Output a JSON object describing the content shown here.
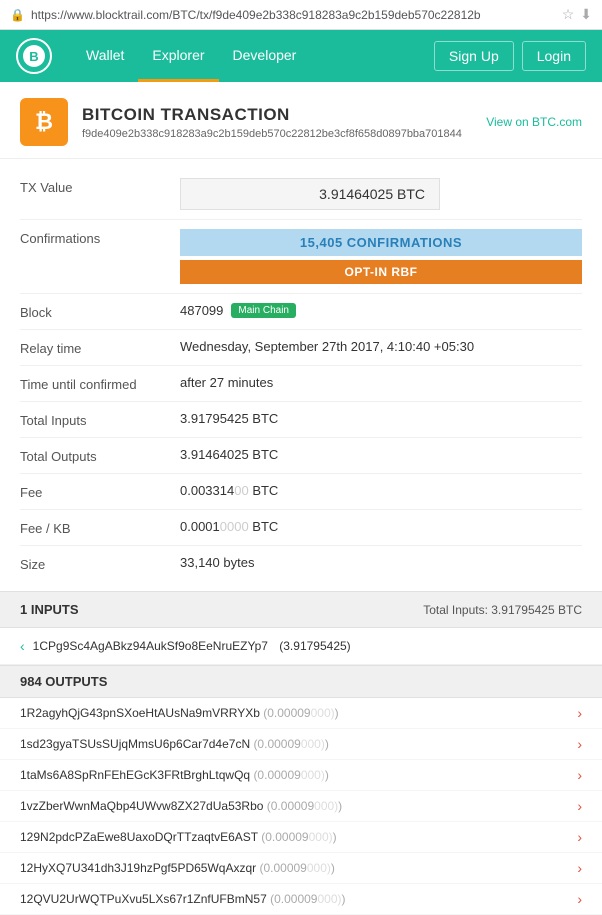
{
  "urlbar": {
    "url": "https://www.blocktrail.com/BTC/tx/f9de409e2b338c918283a9c2b159deb570c22812b",
    "lock_symbol": "🔒"
  },
  "nav": {
    "logo_letter": "B",
    "links": [
      {
        "label": "Wallet",
        "active": false
      },
      {
        "label": "Explorer",
        "active": true
      },
      {
        "label": "Developer",
        "active": false
      }
    ],
    "right_buttons": [
      {
        "label": "Sign Up"
      },
      {
        "label": "Login"
      }
    ]
  },
  "transaction": {
    "icon": "₿",
    "title": "BITCOIN TRANSACTION",
    "hash": "f9de409e2b338c918283a9c2b159deb570c22812be3cf8f658d0897bba701844",
    "view_on_btc": "View on BTC.com",
    "fields": {
      "tx_value_label": "TX Value",
      "tx_value": "3.91464025 BTC",
      "confirmations_label": "Confirmations",
      "confirmations": "15,405 CONFIRMATIONS",
      "opt_in_rbf": "OPT-IN RBF",
      "block_label": "Block",
      "block_number": "487099",
      "block_badge": "Main Chain",
      "relay_time_label": "Relay time",
      "relay_time": "Wednesday, September 27th 2017, 4:10:40 +05:30",
      "time_confirmed_label": "Time until confirmed",
      "time_confirmed": "after 27 minutes",
      "total_inputs_label": "Total Inputs",
      "total_inputs": "3.91795425 BTC",
      "total_outputs_label": "Total Outputs",
      "total_outputs": "3.91464025 BTC",
      "fee_label": "Fee",
      "fee_main": "0.003314",
      "fee_dim": "00",
      "fee_unit": " BTC",
      "fee_kb_label": "Fee / KB",
      "fee_kb_main": "0.0001",
      "fee_kb_dim": "0000",
      "fee_kb_unit": " BTC",
      "size_label": "Size",
      "size": "33,140 bytes"
    }
  },
  "inputs_section": {
    "title": "1 INPUTS",
    "total": "Total Inputs: 3.91795425 BTC",
    "items": [
      {
        "address": "1CPg9Sc4AgABkz94AukSf9o8EeNruEZYp7",
        "amount": "(3.91795425)"
      }
    ]
  },
  "outputs_section": {
    "title": "984 OUTPUTS",
    "items": [
      {
        "address": "1R2agyhQjG43pnSXoeHtAUsNa9mVRRYXb",
        "amount": "(0.00009",
        "dim": "000)"
      },
      {
        "address": "1sd23gyaTSUsSUjqMmsU6p6Car7d4e7cN",
        "amount": "(0.00009",
        "dim": "000)"
      },
      {
        "address": "1taMs6A8SpRnFEhEGcK3FRtBrghLtqwQq",
        "amount": "(0.00009",
        "dim": "000)"
      },
      {
        "address": "1vzZberWwnMaQbp4UWvw8ZX27dUa53Rbo",
        "amount": "(0.00009",
        "dim": "000)"
      },
      {
        "address": "129N2pdcPZaEwe8UaxoDQrTTzaqtvE6AST",
        "amount": "(0.00009",
        "dim": "000)"
      },
      {
        "address": "12HyXQ7U341dh3J19hzPgf5PD65WqAxzqr",
        "amount": "(0.00009",
        "dim": "000)"
      },
      {
        "address": "12QVU2UrWQTPuXvu5LXs67r1ZnfUFBmN57",
        "amount": "(0.00009",
        "dim": "000)"
      }
    ]
  }
}
